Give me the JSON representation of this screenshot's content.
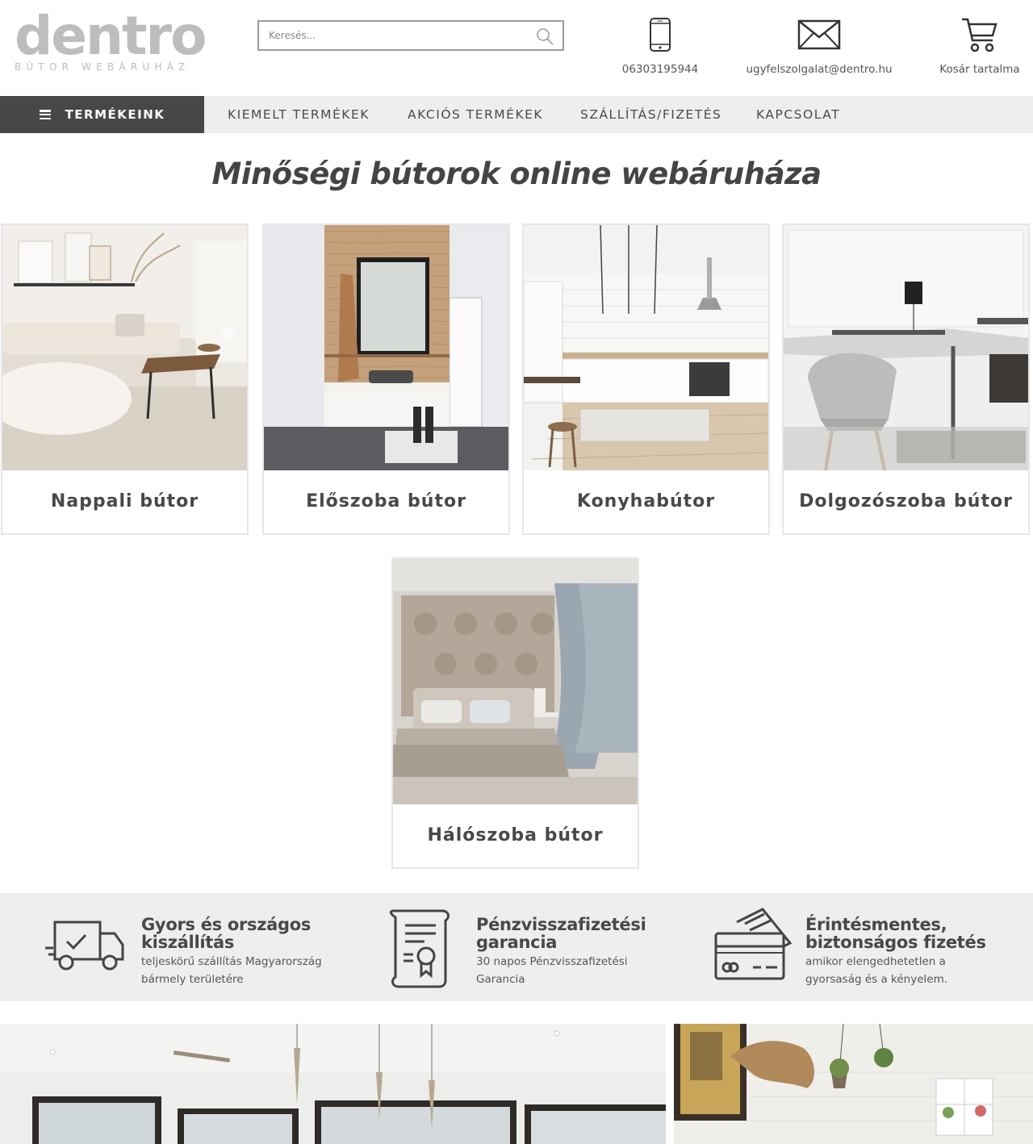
{
  "header": {
    "logo_word": "dentro",
    "logo_tagline": "BÚTOR WEBÁRUHÁZ",
    "search_placeholder": "Keresés...",
    "phone": "06303195944",
    "email": "ugyfelszolgalat@dentro.hu",
    "cart_label": "Kosár tartalma"
  },
  "nav": {
    "main_label": "TERMÉKEINK",
    "links": [
      "KIEMELT TERMÉKEK",
      "AKCIÓS TERMÉKEK",
      "SZÁLLÍTÁS/FIZETÉS",
      "KAPCSOLAT"
    ]
  },
  "page_title": "Minőségi bútorok online webáruháza",
  "categories": [
    {
      "name": "Nappali bútor"
    },
    {
      "name": "Előszoba bútor"
    },
    {
      "name": "Konyhabútor"
    },
    {
      "name": "Dolgozószoba bútor"
    },
    {
      "name": "Hálószoba bútor"
    }
  ],
  "features": [
    {
      "title_line1": "Gyors és országos",
      "title_line2": "kiszállítás",
      "desc_line1": "teljeskörű szállítás Magyarország",
      "desc_line2": "bármely területére",
      "icon": "truck-icon"
    },
    {
      "title_line1": "Pénzvisszafizetési",
      "title_line2": "garancia",
      "desc_line1": "30 napos Pénzvisszafizetési",
      "desc_line2": "Garancia",
      "icon": "certificate-icon"
    },
    {
      "title_line1": "Érintésmentes,",
      "title_line2": "biztonságos fizetés",
      "desc_line1": "amikor elengedhetetlen a",
      "desc_line2": "gyorsaság és a kényelem.",
      "icon": "credit-card-icon"
    }
  ],
  "colors": {
    "nav_dark": "#474747",
    "nav_bg": "#eeeeee",
    "logo_gray": "#bdbdbd",
    "text_dark": "#484848"
  }
}
